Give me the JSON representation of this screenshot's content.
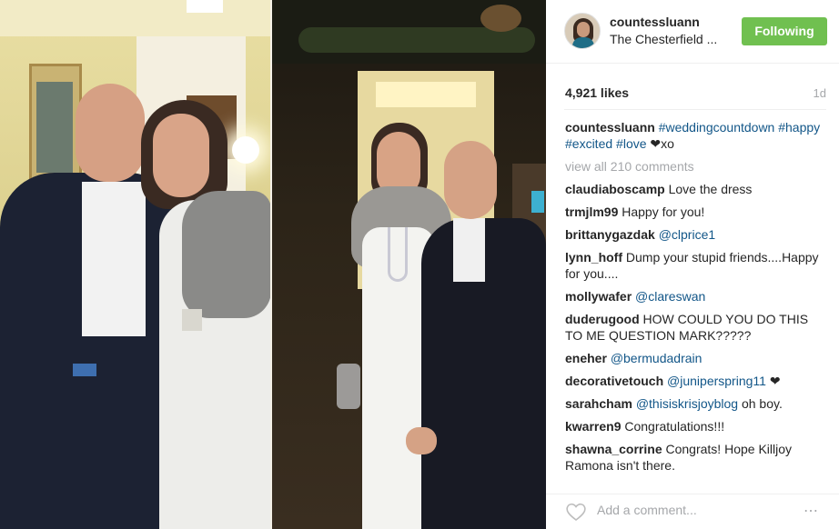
{
  "post": {
    "username": "countessluann",
    "location": "The Chesterfield ...",
    "follow_label": "Following",
    "likes": "4,921 likes",
    "age": "1d"
  },
  "caption": {
    "user": "countessluann",
    "hashtags": [
      "#weddingcountdown",
      "#happy",
      "#excited",
      "#love"
    ],
    "suffix": "❤xo"
  },
  "view_all": "view all 210 comments",
  "comments": [
    {
      "user": "claudiaboscamp",
      "text": "Love the dress",
      "mention": ""
    },
    {
      "user": "trmjlm99",
      "text": "Happy for you!",
      "mention": ""
    },
    {
      "user": "brittanygazdak",
      "text": "",
      "mention": "@clprice1"
    },
    {
      "user": "lynn_hoff",
      "text": "Dump your stupid friends....Happy for you....",
      "mention": ""
    },
    {
      "user": "mollywafer",
      "text": "",
      "mention": "@clareswan"
    },
    {
      "user": "duderugood",
      "text": "HOW COULD YOU DO THIS TO ME QUESTION MARK?????",
      "mention": ""
    },
    {
      "user": "eneher",
      "text": "",
      "mention": "@bermudadrain"
    },
    {
      "user": "decorativetouch",
      "text": "",
      "mention": "@juniperspring11",
      "after": " ❤"
    },
    {
      "user": "sarahcham",
      "text": "",
      "mention": "@thisiskrisjoyblog",
      "after": " oh boy."
    },
    {
      "user": "kwarren9",
      "text": "Congratulations!!!",
      "mention": ""
    },
    {
      "user": "shawna_corrine",
      "text": "Congrats! Hope Killjoy Ramona isn't there.",
      "mention": ""
    }
  ],
  "add_comment_placeholder": "Add a comment...",
  "more_icon": "⋯",
  "icons": {
    "like": "heart-icon",
    "more": "more-options-icon"
  },
  "colors": {
    "follow_button": "#70c050",
    "link": "#125688",
    "muted": "#a5a7aa"
  }
}
